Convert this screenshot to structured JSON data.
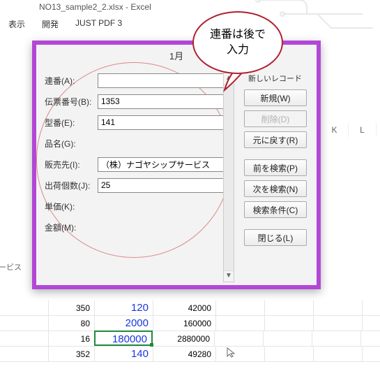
{
  "title_bar": "NO13_sample2_2.xlsx - Excel",
  "ribbon": {
    "tabs": [
      "表示",
      "開発",
      "JUST PDF 3"
    ]
  },
  "dialog": {
    "title": "1月",
    "counter": "新しいレコード",
    "fields": {
      "renban": {
        "label": "連番(A):",
        "value": ""
      },
      "denpyo": {
        "label": "伝票番号(B):",
        "value": "1353"
      },
      "kataban": {
        "label": "型番(E):",
        "value": "141"
      },
      "hinmei": {
        "label": "品名(G):"
      },
      "hanbai": {
        "label": "販売先(I):",
        "value": "（株）ナゴヤシップサービス"
      },
      "shukka": {
        "label": "出荷個数(J):",
        "value": "25"
      },
      "tanka": {
        "label": "単価(K):"
      },
      "kingaku": {
        "label": "金額(M):"
      }
    },
    "buttons": {
      "new": "新規(W)",
      "delete": "削除(D)",
      "restore": "元に戻す(R)",
      "prev": "前を検索(P)",
      "next": "次を検索(N)",
      "cond": "検索条件(C)",
      "close": "閉じる(L)"
    }
  },
  "callout": {
    "line1": "連番は後で",
    "line2": "入力"
  },
  "side_label": "ービス",
  "col_headers": {
    "k": "K",
    "l": "L"
  },
  "grid": {
    "rows": [
      {
        "b": "350",
        "c": "120",
        "d": "42000"
      },
      {
        "b": "80",
        "c": "2000",
        "d": "160000"
      },
      {
        "b": "16",
        "c": "180000",
        "d": "2880000",
        "selected": true
      },
      {
        "b": "352",
        "c": "140",
        "d": "49280"
      }
    ]
  }
}
